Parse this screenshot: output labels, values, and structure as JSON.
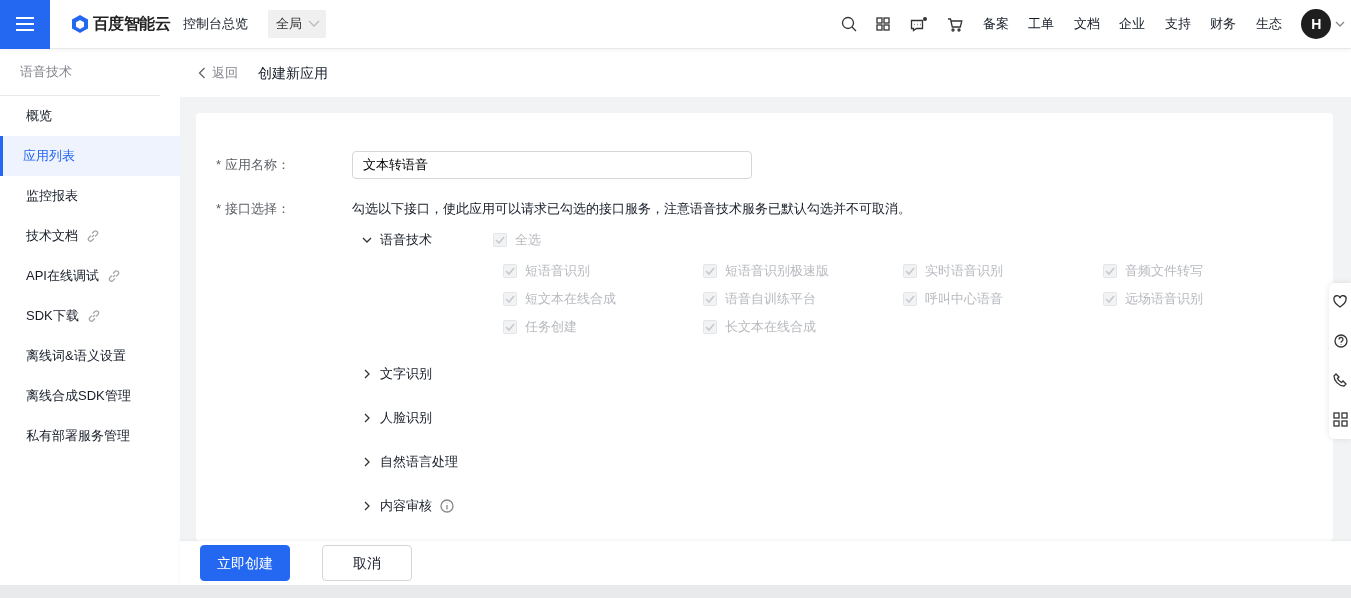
{
  "header": {
    "logo_text": "百度智能云",
    "console": "控制台总览",
    "region": "全局",
    "message_unread": true,
    "nav_links": [
      "备案",
      "工单",
      "文档",
      "企业",
      "支持",
      "财务",
      "生态"
    ],
    "avatar": "H"
  },
  "sidebar": {
    "title": "语音技术",
    "items": [
      {
        "label": "概览",
        "selected": false,
        "external": false
      },
      {
        "label": "应用列表",
        "selected": true,
        "external": false
      },
      {
        "label": "监控报表",
        "selected": false,
        "external": false
      },
      {
        "label": "技术文档",
        "selected": false,
        "external": true
      },
      {
        "label": "API在线调试",
        "selected": false,
        "external": true
      },
      {
        "label": "SDK下载",
        "selected": false,
        "external": true
      },
      {
        "label": "离线词&语义设置",
        "selected": false,
        "external": false
      },
      {
        "label": "离线合成SDK管理",
        "selected": false,
        "external": false
      },
      {
        "label": "私有部署服务管理",
        "selected": false,
        "external": false
      }
    ]
  },
  "breadcrumb": {
    "back": "返回",
    "title": "创建新应用"
  },
  "form": {
    "name_field": {
      "label": "* 应用名称：",
      "value": "文本转语音"
    },
    "api_field": {
      "label": "* 接口选择：",
      "hint": "勾选以下接口，使此应用可以请求已勾选的接口服务，注意语音技术服务已默认勾选并不可取消。",
      "groups": [
        {
          "label": "语音技术",
          "expanded": true,
          "info": false,
          "select_all": {
            "label": "全选",
            "checked": true,
            "disabled": true
          },
          "items": [
            {
              "label": "短语音识别",
              "checked": true,
              "disabled": true
            },
            {
              "label": "短语音识别极速版",
              "checked": true,
              "disabled": true
            },
            {
              "label": "实时语音识别",
              "checked": true,
              "disabled": true
            },
            {
              "label": "音频文件转写",
              "checked": true,
              "disabled": true
            },
            {
              "label": "短文本在线合成",
              "checked": true,
              "disabled": true
            },
            {
              "label": "语音自训练平台",
              "checked": true,
              "disabled": true
            },
            {
              "label": "呼叫中心语音",
              "checked": true,
              "disabled": true
            },
            {
              "label": "远场语音识别",
              "checked": true,
              "disabled": true
            },
            {
              "label": "任务创建",
              "checked": true,
              "disabled": true
            },
            {
              "label": "长文本在线合成",
              "checked": true,
              "disabled": true
            }
          ]
        },
        {
          "label": "文字识别",
          "expanded": false,
          "info": false
        },
        {
          "label": "人脸识别",
          "expanded": false,
          "info": false
        },
        {
          "label": "自然语言处理",
          "expanded": false,
          "info": false
        },
        {
          "label": "内容审核",
          "expanded": false,
          "info": true
        }
      ]
    }
  },
  "footer": {
    "buttons": [
      {
        "label": "立即创建",
        "kind": "primary"
      },
      {
        "label": "取消",
        "kind": "secondary"
      }
    ]
  }
}
